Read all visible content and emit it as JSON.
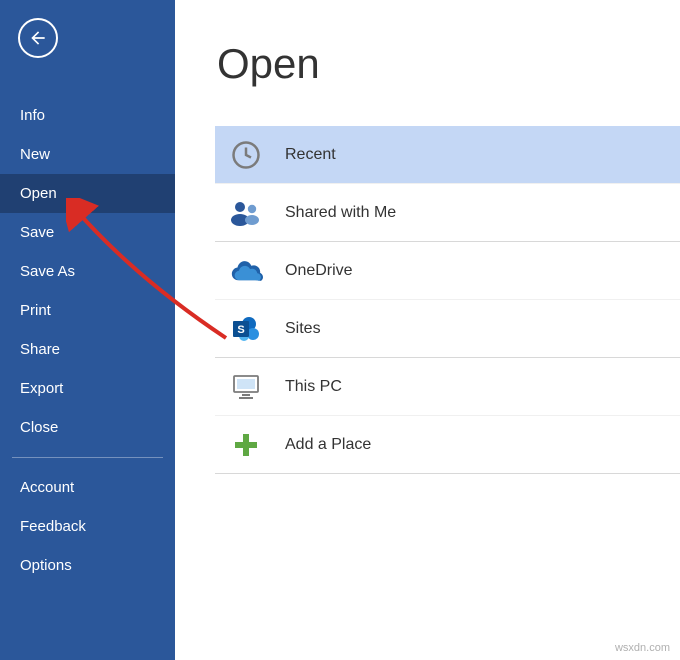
{
  "sidebar": {
    "items": [
      {
        "label": "Info",
        "selected": false
      },
      {
        "label": "New",
        "selected": false
      },
      {
        "label": "Open",
        "selected": true
      },
      {
        "label": "Save",
        "selected": false
      },
      {
        "label": "Save As",
        "selected": false
      },
      {
        "label": "Print",
        "selected": false
      },
      {
        "label": "Share",
        "selected": false
      },
      {
        "label": "Export",
        "selected": false
      },
      {
        "label": "Close",
        "selected": false
      }
    ],
    "footer_items": [
      {
        "label": "Account"
      },
      {
        "label": "Feedback"
      },
      {
        "label": "Options"
      }
    ]
  },
  "main": {
    "title": "Open",
    "locations": [
      {
        "label": "Recent",
        "icon": "clock",
        "selected": true,
        "divide_after": false
      },
      {
        "label": "Shared with Me",
        "icon": "people",
        "selected": false,
        "divide_after": true
      },
      {
        "label": "OneDrive",
        "icon": "cloud",
        "selected": false,
        "divide_after": false
      },
      {
        "label": "Sites",
        "icon": "sharepoint",
        "selected": false,
        "divide_after": true
      },
      {
        "label": "This PC",
        "icon": "pc",
        "selected": false,
        "divide_after": false
      },
      {
        "label": "Add a Place",
        "icon": "plus",
        "selected": false,
        "divide_after": true
      }
    ]
  },
  "watermark": "wsxdn.com",
  "colors": {
    "sidebar_bg": "#2b579a",
    "sidebar_selected": "#204072",
    "location_selected": "#c4d7f5",
    "arrow": "#d92c24"
  }
}
